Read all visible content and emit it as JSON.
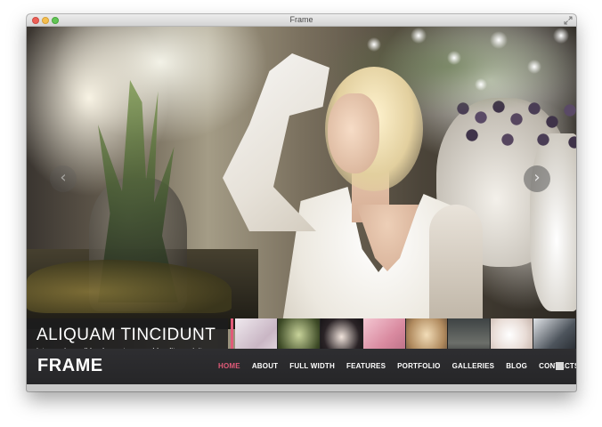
{
  "window": {
    "title": "Frame"
  },
  "slider": {
    "caption_title": "ALIQUAM TINCIDUNT",
    "caption_text": "integer risus nibh, elementum non blandit suscipit.",
    "prev_icon": "chevron-left-icon",
    "next_icon": "chevron-right-icon",
    "prev_glyph": "‹",
    "next_glyph": "›",
    "accent_color": "#e05a78",
    "active_index": 0,
    "thumbnails": [
      {
        "name": "thumb-1"
      },
      {
        "name": "thumb-2"
      },
      {
        "name": "thumb-3"
      },
      {
        "name": "thumb-4"
      },
      {
        "name": "thumb-5"
      },
      {
        "name": "thumb-6"
      },
      {
        "name": "thumb-7"
      },
      {
        "name": "thumb-8"
      }
    ]
  },
  "header": {
    "logo": "FRAME",
    "nav": [
      {
        "label": "HOME",
        "active": true
      },
      {
        "label": "ABOUT",
        "active": false
      },
      {
        "label": "FULL WIDTH",
        "active": false
      },
      {
        "label": "FEATURES",
        "active": false
      },
      {
        "label": "PORTFOLIO",
        "active": false
      },
      {
        "label": "GALLERIES",
        "active": false
      },
      {
        "label": "BLOG",
        "active": false
      },
      {
        "label": "CONTACTS",
        "active": false
      }
    ],
    "menu_icon": "menu-toggle-icon",
    "active_color": "#e05a78"
  }
}
